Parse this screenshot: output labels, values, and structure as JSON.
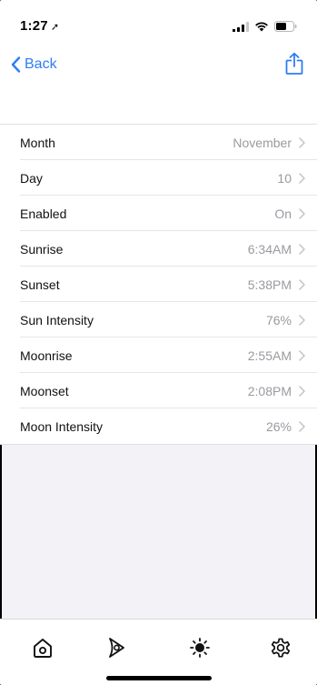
{
  "status_bar": {
    "time": "1:27",
    "location_arrow": "➚"
  },
  "nav": {
    "back_label": "Back",
    "share_icon": "share-icon"
  },
  "rows": [
    {
      "label": "Month",
      "value": "November"
    },
    {
      "label": "Day",
      "value": "10"
    },
    {
      "label": "Enabled",
      "value": "On"
    },
    {
      "label": "Sunrise",
      "value": "6:34AM"
    },
    {
      "label": "Sunset",
      "value": "5:38PM"
    },
    {
      "label": "Sun Intensity",
      "value": "76%"
    },
    {
      "label": "Moonrise",
      "value": "2:55AM"
    },
    {
      "label": "Moonset",
      "value": "2:08PM"
    },
    {
      "label": "Moon Intensity",
      "value": "26%"
    }
  ],
  "tab_bar": {
    "tabs": [
      "home-icon",
      "sail-icon",
      "sun-icon",
      "gear-icon"
    ]
  },
  "colors": {
    "accent": "#2f7cf6",
    "secondary_text": "#9a9aa0",
    "background": "#f2f2f7"
  }
}
